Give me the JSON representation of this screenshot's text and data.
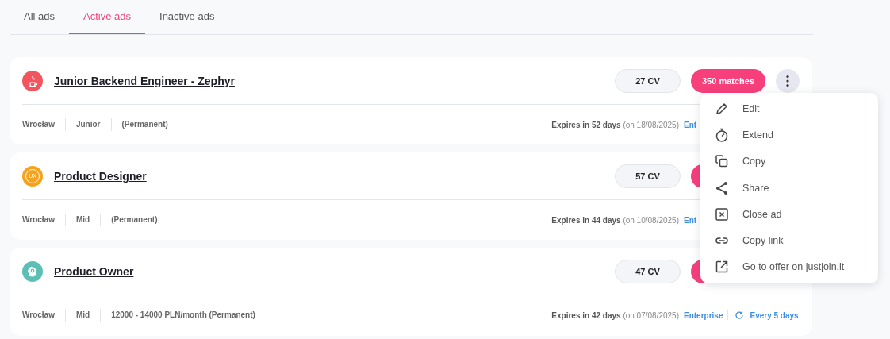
{
  "tabs": [
    {
      "label": "All ads",
      "selected": false
    },
    {
      "label": "Active ads",
      "selected": true
    },
    {
      "label": "Inactive ads",
      "selected": false
    }
  ],
  "ads": [
    {
      "icon": {
        "kind": "java",
        "color": "#f2555e"
      },
      "title": "Junior Backend Engineer - Zephyr",
      "cv": "27 CV",
      "matches_button": true,
      "matches": "350 matches",
      "more_button": true,
      "location": "Wrocław",
      "level": "Junior",
      "contract": "(Permanent)",
      "expires": "**Expires in 52 days** (on 18/08/2025)",
      "plan": "Ent"
    },
    {
      "icon": {
        "kind": "ux",
        "color": "#f7a21d",
        "text": "UX"
      },
      "title": "Product Designer",
      "cv": "57 CV",
      "matches_button": true,
      "more_button": false,
      "location": "Wrocław",
      "level": "Mid",
      "contract": "(Permanent)",
      "expires": "**Expires in 44 days** (on 10/08/2025)",
      "plan": "Ent"
    },
    {
      "icon": {
        "kind": "head",
        "color": "#5bbfb3"
      },
      "title": "Product Owner",
      "cv": "47 CV",
      "matches_button": true,
      "more_button": false,
      "location": "Wrocław",
      "level": "Mid",
      "contract": "12000 - 14000 PLN/month (Permanent)",
      "expires": "**Expires in 42 days** (on 07/08/2025)",
      "plan": "Enterprise",
      "refresh": "Every 5 days"
    }
  ],
  "menu": [
    {
      "kind": "edit",
      "label": "Edit"
    },
    {
      "kind": "timer",
      "label": "Extend"
    },
    {
      "kind": "copy",
      "label": "Copy"
    },
    {
      "kind": "share",
      "label": "Share"
    },
    {
      "kind": "close",
      "label": "Close ad"
    },
    {
      "kind": "link",
      "label": "Copy link"
    },
    {
      "kind": "external",
      "label": "Go to offer on justjoin.it"
    }
  ]
}
